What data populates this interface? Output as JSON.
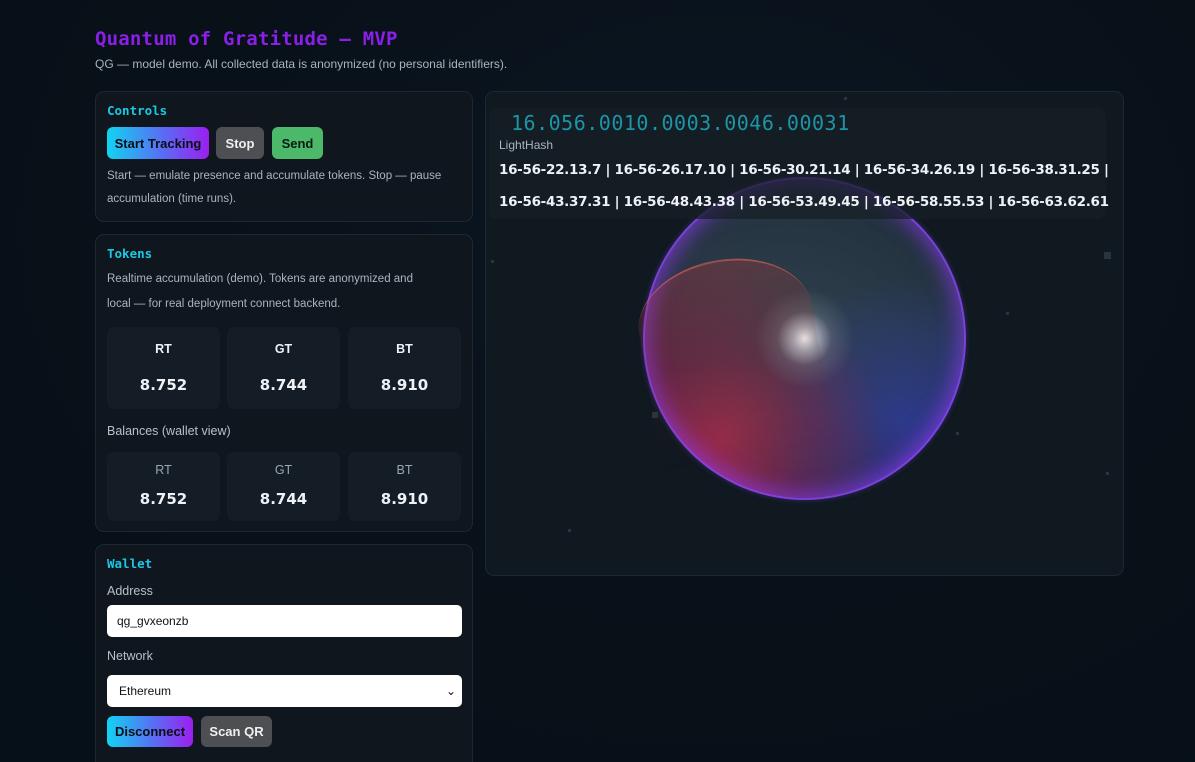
{
  "header": {
    "title": "Quantum of Gratitude — MVP",
    "subtitle": "QG — model demo. All collected data is anonymized (no personal identifiers)."
  },
  "controls": {
    "title": "Controls",
    "start_label": "Start Tracking",
    "stop_label": "Stop",
    "send_label": "Send",
    "help_line1": "Start — emulate presence and accumulate tokens. Stop — pause",
    "help_line2": "accumulation (time runs)."
  },
  "tokens": {
    "title": "Tokens",
    "desc_line1": "Realtime accumulation (demo). Tokens are anonymized and",
    "desc_line2": "local — for real deployment connect backend.",
    "realtime": [
      {
        "label": "RT",
        "value": "8.752"
      },
      {
        "label": "GT",
        "value": "8.744"
      },
      {
        "label": "BT",
        "value": "8.910"
      }
    ],
    "balances_label": "Balances (wallet view)",
    "balances": [
      {
        "label": "RT",
        "value": "8.752"
      },
      {
        "label": "GT",
        "value": "8.744"
      },
      {
        "label": "BT",
        "value": "8.910"
      }
    ]
  },
  "wallet": {
    "title": "Wallet",
    "address_label": "Address",
    "address_value": "qg_gvxeonzb",
    "network_label": "Network",
    "network_value": "Ethereum",
    "disconnect_label": "Disconnect",
    "scan_label": "Scan QR"
  },
  "lighthash": {
    "code": "16.056.0010.0003.0046.00031",
    "label": "LightHash",
    "line1": "16-56-22.13.7 | 16-56-26.17.10 | 16-56-30.21.14 | 16-56-34.26.19 | 16-56-38.31.25 |",
    "line2": "16-56-43.37.31 | 16-56-48.43.38 | 16-56-53.49.45 | 16-56-58.55.53 | 16-56-63.62.61"
  },
  "colors": {
    "accent_purple": "#8a1fe8",
    "accent_cyan": "#1bc8e4",
    "send_green": "#4cb96a"
  }
}
